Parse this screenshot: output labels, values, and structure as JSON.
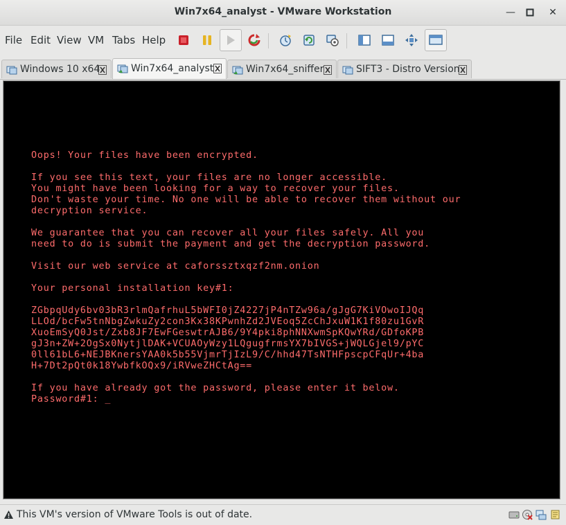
{
  "window": {
    "title": "Win7x64_analyst - VMware Workstation",
    "minimize_glyph": "—",
    "maximize_glyph": "□",
    "close_glyph": "✕"
  },
  "menu": [
    "File",
    "Edit",
    "View",
    "VM",
    "Tabs",
    "Help"
  ],
  "toolbar_icons": [
    "power-off-icon",
    "pause-icon",
    "play-icon",
    "reset-icon",
    "snapshot-icon",
    "revert-snapshot-icon",
    "snapshot-manager-icon",
    "show-sidebar-icon",
    "show-thumbnails-icon",
    "fit-guest-icon",
    "console-view-icon"
  ],
  "tabs": [
    {
      "label": "Windows 10 x64",
      "active": false
    },
    {
      "label": "Win7x64_analyst",
      "active": true
    },
    {
      "label": "Win7x64_sniffer",
      "active": false
    },
    {
      "label": "SIFT3 - Distro Version",
      "active": false
    }
  ],
  "console": {
    "lines": [
      "Oops! Your files have been encrypted.",
      "",
      "If you see this text, your files are no longer accessible.",
      "You might have been looking for a way to recover your files.",
      "Don't waste your time. No one will be able to recover them without our",
      "decryption service.",
      "",
      "We guarantee that you can recover all your files safely. All you",
      "need to do is submit the payment and get the decryption password.",
      "",
      "Visit our web service at caforssztxqzf2nm.onion",
      "",
      "Your personal installation key#1:",
      "",
      "ZGbpqUdy6bv03bR3rlmQafrhuL5bWFI0jZ4227jP4nTZw96a/gJgG7KiVOwoIJQq",
      "LLOd/bcFw5tnNbgZwkuZy2con3Kx38KPwnhZd2JVEoq5ZcChJxuW1K1f80zu1GvR",
      "XuoEmSyQ0Jst/Zxb8JF7EwFGeswtrAJB6/9Y4pki8phNNXwmSpKQwYRd/GDfoKPB",
      "gJ3n+ZW+2OgSx0NytjlDAK+VCUAOyWzy1LQgugfrmsYX7bIVGS+jWQLGjel9/pYC",
      "0ll61bL6+NEJBKnersYAA0k5b55VjmrTjIzL9/C/hhd47TsNTHFpscpCFqUr+4ba",
      "H+7Dt2pQt0k18YwbfkOQx9/iRVweZHCtAg==",
      "",
      "If you have already got the password, please enter it below.",
      "Password#1: "
    ],
    "cursor": "_"
  },
  "status": {
    "message": "This VM's version of VMware Tools is out of date."
  }
}
